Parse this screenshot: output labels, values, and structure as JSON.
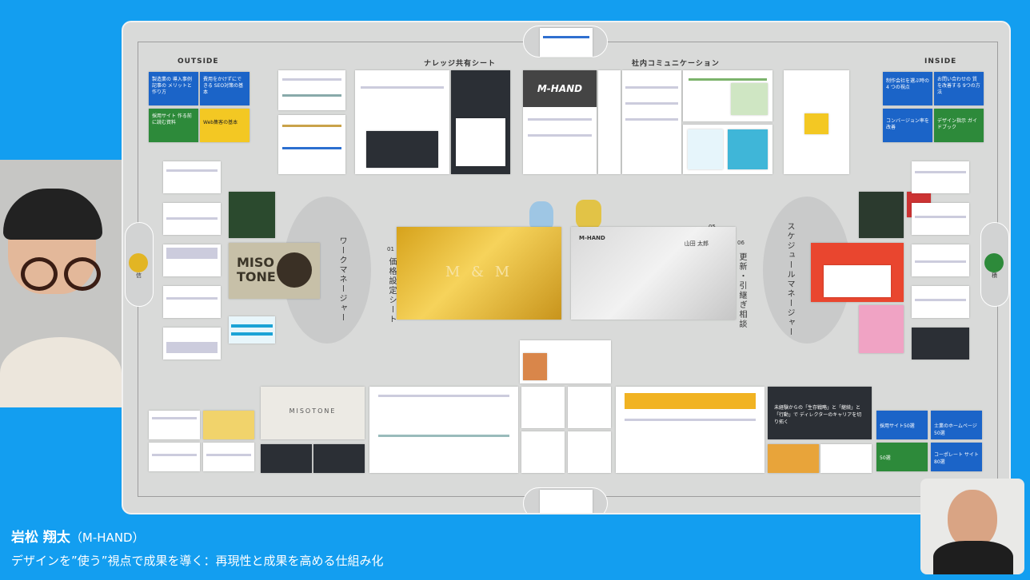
{
  "board": {
    "sections": {
      "outside": "OUTSIDE",
      "knowledge": "ナレッジ共有シート",
      "internal": "社内コミュニケーション",
      "inside": "INSIDE"
    },
    "vertical_labels": {
      "work_manager": "ワークマネージャー",
      "pricing_sheet": "価格設定シート",
      "update_handover": "更新・引継ぎ相談",
      "schedule_manager": "スケジュールマネージャー"
    },
    "numbers": {
      "n01": "01",
      "n05": "05",
      "n06": "06"
    },
    "left_dot_label": "信",
    "right_dot_label": "積",
    "center_card_logo": "M & M",
    "silver_card_title": "M-HAND",
    "silver_card_name": "山田 太郎",
    "thumb_mhand": "M-HAND",
    "miso_label": "MISO TONE",
    "misotone_label": "MISOTONE",
    "thumb_texts": {
      "outside_1": "製造業の 導入事例記事の メリットと作り方",
      "outside_2": "費用をかけずにできる SEO対策の基本",
      "outside_3": "採用サイト 作る前に読む資料",
      "outside_4": "Web集客の基本",
      "inside_1": "制作会社を選ぶ時の 4 つの視点",
      "inside_2": "お問い合わせの 質を改善する 9つの方法",
      "inside_3": "コンバージョン率を 改善",
      "inside_4": "デザイン指示 ガイドブック",
      "inside_5": "採用サイト50選",
      "inside_6": "50選",
      "inside_7": "士業のホームページ 50選",
      "inside_8": "コーポレート サイト80選",
      "career": "未経験からの「生存戦略」と「継続」と「行動」で ディレクターのキャリアを切り拓く"
    }
  },
  "speaker": {
    "name": "岩松 翔太",
    "affiliation": "（M-HAND）",
    "title": "デザインを”使う”視点で成果を導く：再現性と成果を高める仕組み化"
  },
  "colors": {
    "background": "#139ef0",
    "board": "#d9dad9",
    "left_dot": "#e2b524",
    "right_dot": "#2d8a3a"
  }
}
